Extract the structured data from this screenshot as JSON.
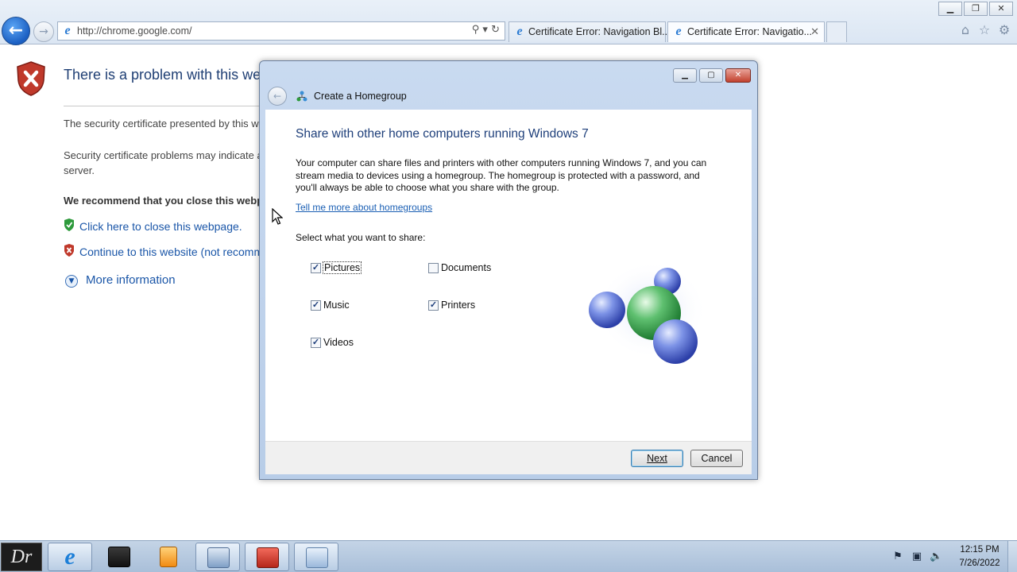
{
  "browser": {
    "address": "http://chrome.google.com/",
    "tabs": [
      {
        "label": "Certificate Error: Navigation Bl..."
      },
      {
        "label": "Certificate Error: Navigatio..."
      }
    ]
  },
  "error_page": {
    "title": "There is a problem with this website's security certificate.",
    "p1": "The security certificate presented by this website was issued for a different website's address.",
    "p2_line1": "Security certificate problems may indicate an attempt to fool you or intercept any data you send to the",
    "p2_line2": "server.",
    "recommend": "We recommend that you close this webpage and do not continue to this website.",
    "link_close": "Click here to close this webpage.",
    "link_continue": "Continue to this website (not recommended).",
    "more_info": "More information"
  },
  "dialog": {
    "title": "Create a Homegroup",
    "heading": "Share with other home computers running Windows 7",
    "description": "Your computer can share files and printers with other computers running Windows 7, and you can stream media to devices using a homegroup. The homegroup is protected with a password, and you'll always be able to choose what you share with the group.",
    "link": "Tell me more about homegroups",
    "select_label": "Select what you want to share:",
    "options": {
      "pictures": {
        "label": "Pictures",
        "checked": true
      },
      "documents": {
        "label": "Documents",
        "checked": false
      },
      "music": {
        "label": "Music",
        "checked": true
      },
      "printers": {
        "label": "Printers",
        "checked": true
      },
      "videos": {
        "label": "Videos",
        "checked": true
      }
    },
    "next_label": "Next",
    "cancel_label": "Cancel"
  },
  "taskbar": {
    "start_label": "Dr",
    "clock_time": "12:15 PM",
    "clock_date": "7/26/2022"
  },
  "colors": {
    "dialog_heading": "#1e3f7a",
    "link": "#1a56a8",
    "error_red": "#c0392b",
    "shield_green": "#2e9a3c"
  }
}
